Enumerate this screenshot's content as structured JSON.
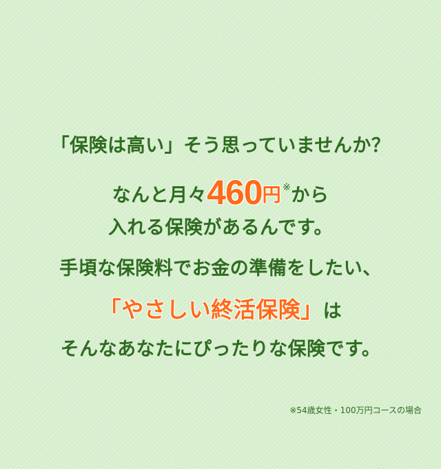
{
  "message": {
    "line1": "「保険は高い」そう思っていませんか？",
    "line2_prefix": "なんと月々",
    "price_value": "460",
    "price_unit": "円",
    "price_mark": "※",
    "line2_suffix": "から",
    "line3": "入れる保険があるんです。",
    "line4": "手頃な保険料でお金の準備をしたい、",
    "product_name": "「やさしい終活保険」",
    "line5_suffix": "は",
    "line6": "そんなあなたにぴったりな保険です。"
  },
  "footnote": "※54歳女性・100万円コースの場合",
  "colors": {
    "background": "#d9f0d0",
    "text": "#2f6b22",
    "accent": "#ff6a1a"
  }
}
